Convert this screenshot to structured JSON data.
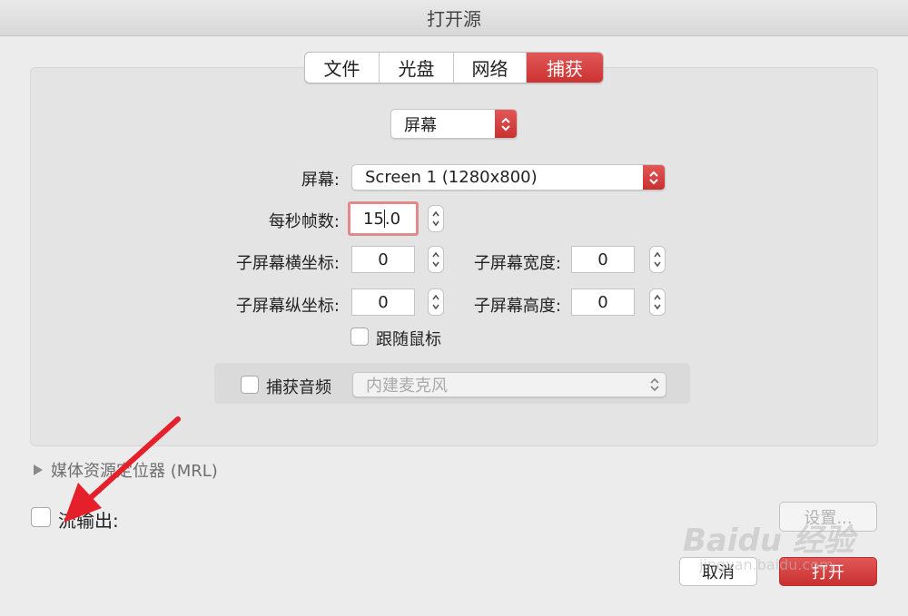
{
  "window": {
    "title": "打开源"
  },
  "tabs": [
    {
      "label": "文件"
    },
    {
      "label": "光盘"
    },
    {
      "label": "网络"
    },
    {
      "label": "捕获"
    }
  ],
  "capture": {
    "mode_select": "屏幕",
    "screen_label": "屏幕:",
    "screen_value": "Screen 1 (1280x800)",
    "fps_label": "每秒帧数:",
    "fps_before_caret": "15",
    "fps_after_caret": ".0",
    "subscreen_x_label": "子屏幕横坐标:",
    "subscreen_x_value": "0",
    "subscreen_width_label": "子屏幕宽度:",
    "subscreen_width_value": "0",
    "subscreen_y_label": "子屏幕纵坐标:",
    "subscreen_y_value": "0",
    "subscreen_height_label": "子屏幕高度:",
    "subscreen_height_value": "0",
    "follow_mouse_label": "跟随鼠标",
    "audio_label": "捕获音频",
    "audio_device": "内建麦克风"
  },
  "mrl": {
    "label": "媒体资源定位器 (MRL)"
  },
  "stream": {
    "label": "流输出:",
    "settings_button": "设置..."
  },
  "buttons": {
    "cancel": "取消",
    "open": "打开"
  },
  "watermark": {
    "logo": "Baidu 经验",
    "url": "jingyan.baidu.com"
  },
  "colors": {
    "accent": "#d23b3b",
    "annotation_arrow": "#e5202a"
  }
}
